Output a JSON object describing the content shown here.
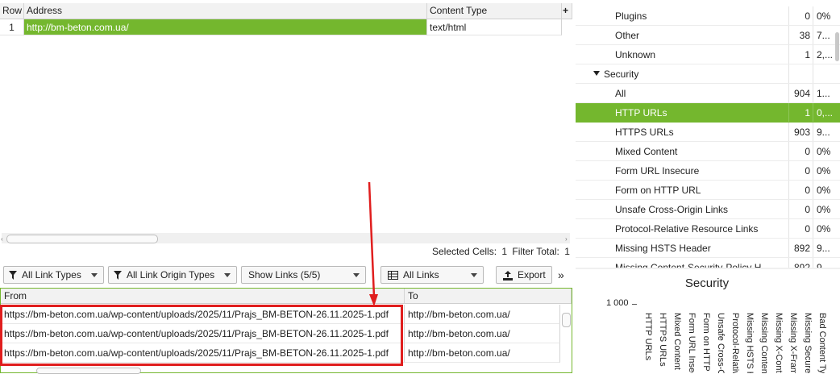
{
  "top_grid": {
    "headers": {
      "row": "Row",
      "address": "Address",
      "content_type": "Content Type",
      "add": "+"
    },
    "rows": [
      {
        "row": "1",
        "address": "http://bm-beton.com.ua/",
        "content_type": "text/html"
      }
    ],
    "status": {
      "selected_label": "Selected Cells:",
      "selected_value": "1",
      "filter_label": "Filter Total:",
      "filter_value": "1"
    }
  },
  "toolbar": {
    "link_types": "All Link Types",
    "link_origin_types": "All Link Origin Types",
    "show_links": "Show Links (5/5)",
    "all_links": "All Links",
    "export": "Export",
    "more": "»"
  },
  "bottom_grid": {
    "headers": {
      "from": "From",
      "to": "To"
    },
    "rows": [
      {
        "from": "https://bm-beton.com.ua/wp-content/uploads/2025/11/Prajs_BM-BETON-26.11.2025-1.pdf",
        "to": "http://bm-beton.com.ua/"
      },
      {
        "from": "https://bm-beton.com.ua/wp-content/uploads/2025/11/Prajs_BM-BETON-26.11.2025-1.pdf",
        "to": "http://bm-beton.com.ua/"
      },
      {
        "from": "https://bm-beton.com.ua/wp-content/uploads/2025/11/Prajs_BM-BETON-26.11.2025-1.pdf",
        "to": "http://bm-beton.com.ua/"
      }
    ]
  },
  "right_panel": {
    "rows": [
      {
        "name": "Plugins",
        "count": "0",
        "pct": "0%"
      },
      {
        "name": "Other",
        "count": "38",
        "pct": "7..."
      },
      {
        "name": "Unknown",
        "count": "1",
        "pct": "2,..."
      },
      {
        "name": "Security",
        "count": "",
        "pct": "",
        "group": true
      },
      {
        "name": "All",
        "count": "904",
        "pct": "1..."
      },
      {
        "name": "HTTP URLs",
        "count": "1",
        "pct": "0,...",
        "selected": true
      },
      {
        "name": "HTTPS URLs",
        "count": "903",
        "pct": "9..."
      },
      {
        "name": "Mixed Content",
        "count": "0",
        "pct": "0%"
      },
      {
        "name": "Form URL Insecure",
        "count": "0",
        "pct": "0%"
      },
      {
        "name": "Form on HTTP URL",
        "count": "0",
        "pct": "0%"
      },
      {
        "name": "Unsafe Cross-Origin Links",
        "count": "0",
        "pct": "0%"
      },
      {
        "name": "Protocol-Relative Resource Links",
        "count": "0",
        "pct": "0%"
      },
      {
        "name": "Missing HSTS Header",
        "count": "892",
        "pct": "9..."
      },
      {
        "name": "Missing Content-Security-Policy H...",
        "count": "892",
        "pct": "9..."
      }
    ]
  },
  "chart_data": {
    "type": "bar",
    "title": "Security",
    "y_tick": "1 000",
    "categories": [
      "HTTP URLs",
      "HTTPS URLs",
      "Mixed Content",
      "Form URL Insecure",
      "Form on HTTP URL",
      "Unsafe Cross-Origin Links",
      "Protocol-Relative Resource Links",
      "Missing HSTS Header",
      "Missing Content-Security-Policy",
      "Missing X-Content-Type-Options",
      "Missing X-Frame-Options",
      "Missing Secure Referrer-Policy",
      "Bad Content Type"
    ]
  },
  "colors": {
    "accent": "#74b72e",
    "annotation": "#e01e1e"
  }
}
